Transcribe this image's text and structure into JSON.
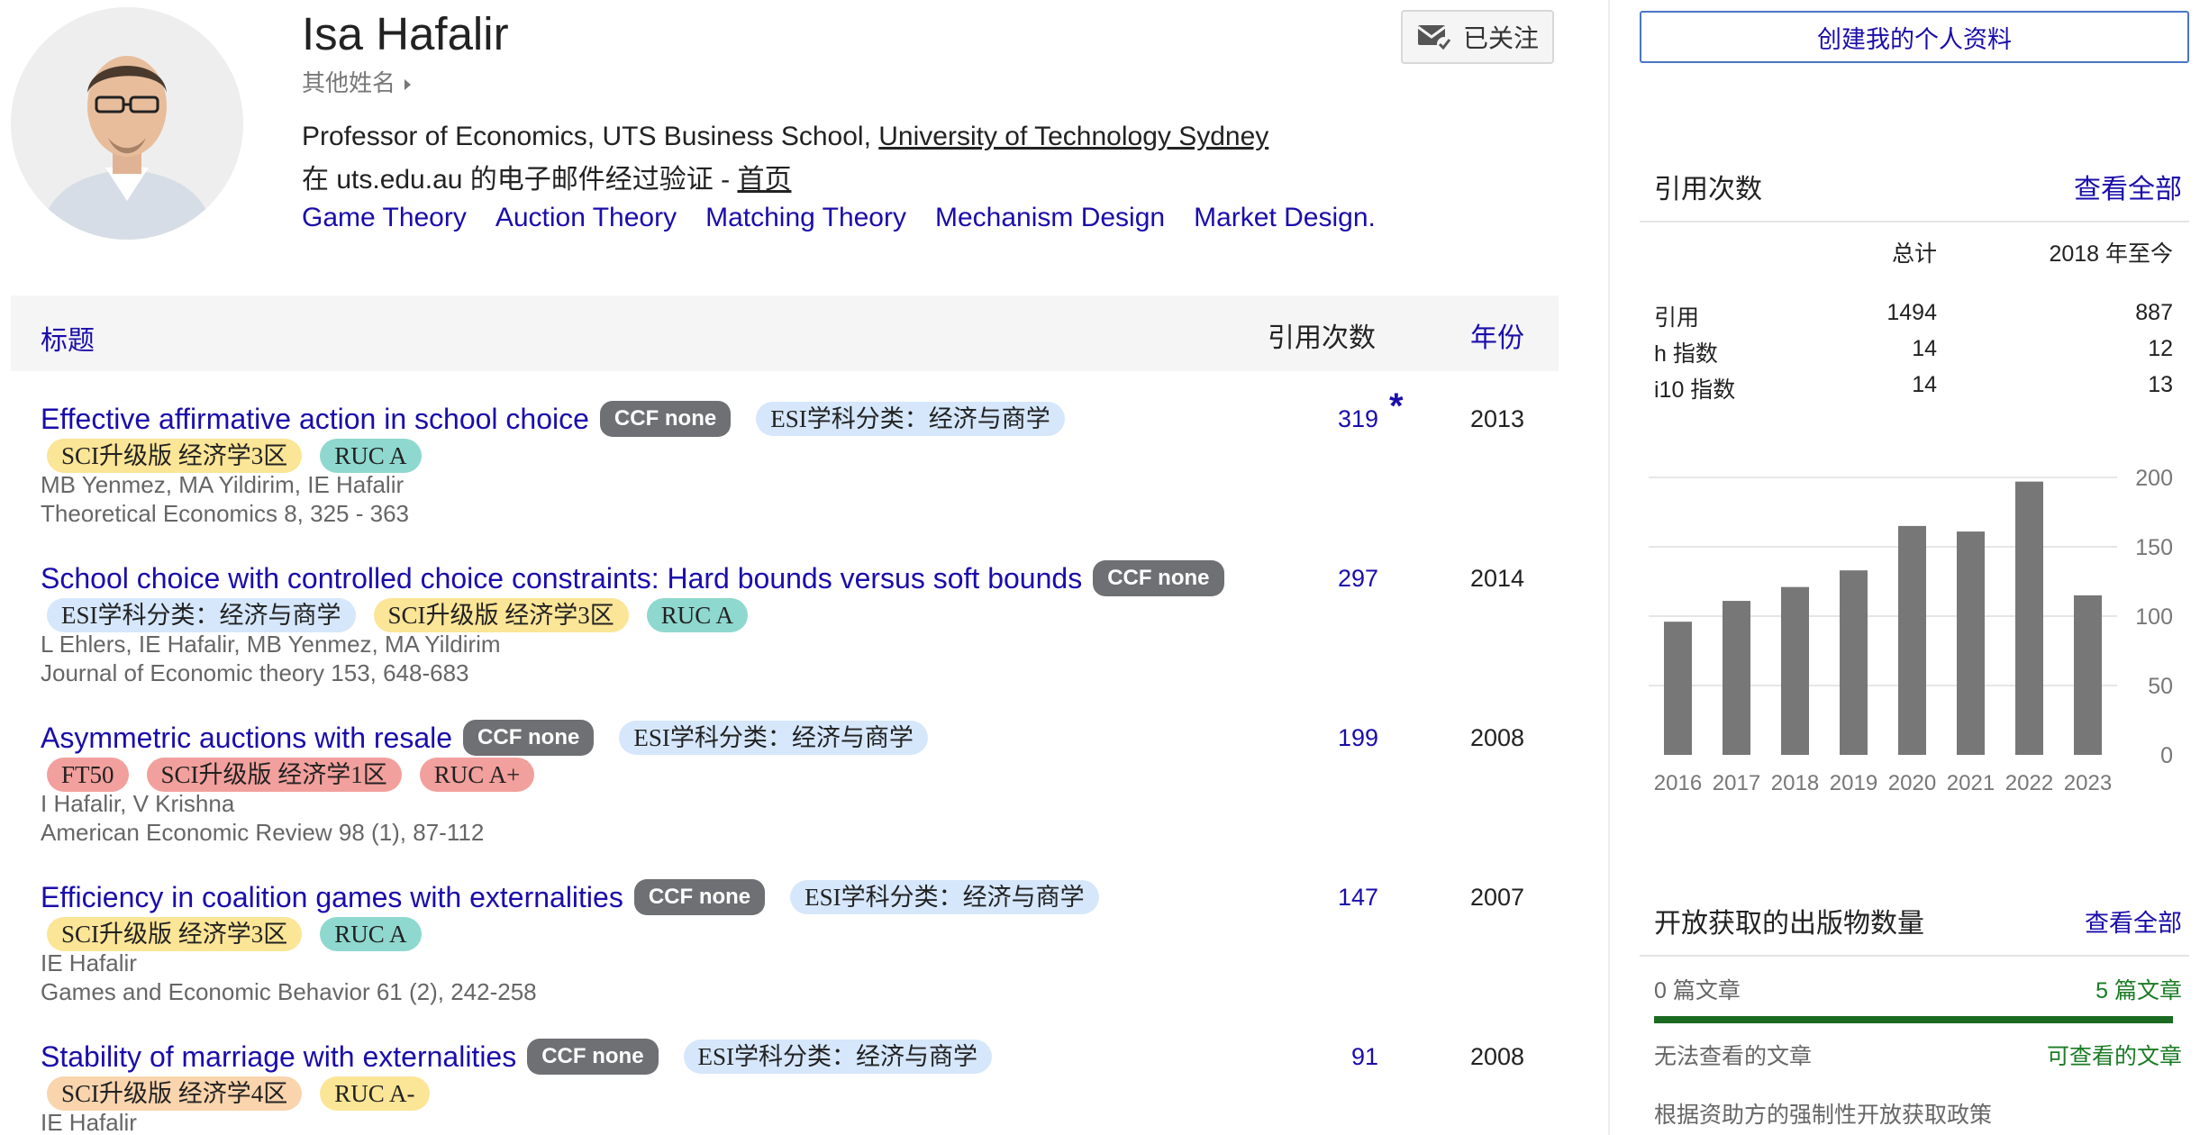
{
  "profile": {
    "name": "Isa Hafalir",
    "other_names": "其他姓名",
    "follow_label": "已关注",
    "affiliation_prefix": "Professor of Economics, UTS Business School, ",
    "affiliation_link": "University of Technology Sydney",
    "verified_prefix": "在 uts.edu.au 的电子邮件经过验证 - ",
    "homepage_label": "首页",
    "interests": [
      "Game Theory",
      "Auction Theory",
      "Matching Theory",
      "Mechanism Design",
      "Market Design."
    ]
  },
  "table": {
    "col_title": "标题",
    "col_cites": "引用次数",
    "col_year": "年份",
    "rows": [
      {
        "title": "Effective affirmative action in school choice",
        "tags1": [
          {
            "label": "CCF none",
            "kind": "ccf"
          },
          {
            "label": "ESI学科分类：经济与商学",
            "kind": "esi"
          }
        ],
        "tags2": [
          {
            "label": "SCI升级版 经济学3区",
            "kind": "sci3"
          },
          {
            "label": "RUC A",
            "kind": "ruca"
          }
        ],
        "authors": "MB Yenmez, MA Yildirim, IE Hafalir",
        "venue": "Theoretical Economics 8, 325 - 363",
        "cites": "319",
        "star": "*",
        "year": "2013"
      },
      {
        "title": "School choice with controlled choice constraints: Hard bounds versus soft bounds",
        "tags1": [
          {
            "label": "CCF none",
            "kind": "ccf"
          }
        ],
        "tags2": [
          {
            "label": "ESI学科分类：经济与商学",
            "kind": "esi"
          },
          {
            "label": "SCI升级版 经济学3区",
            "kind": "sci3"
          },
          {
            "label": "RUC A",
            "kind": "ruca"
          }
        ],
        "authors": "L Ehlers, IE Hafalir, MB Yenmez, MA Yildirim",
        "venue": "Journal of Economic theory 153, 648-683",
        "cites": "297",
        "year": "2014"
      },
      {
        "title": "Asymmetric auctions with resale",
        "tags1": [
          {
            "label": "CCF none",
            "kind": "ccf"
          },
          {
            "label": "ESI学科分类：经济与商学",
            "kind": "esi"
          }
        ],
        "tags2": [
          {
            "label": "FT50",
            "kind": "ft50"
          },
          {
            "label": "SCI升级版 经济学1区",
            "kind": "sci1"
          },
          {
            "label": "RUC A+",
            "kind": "rucap"
          }
        ],
        "authors": "I Hafalir, V Krishna",
        "venue": "American Economic Review 98 (1), 87-112",
        "cites": "199",
        "year": "2008"
      },
      {
        "title": "Efficiency in coalition games with externalities",
        "tags1": [
          {
            "label": "CCF none",
            "kind": "ccf"
          },
          {
            "label": "ESI学科分类：经济与商学",
            "kind": "esi"
          }
        ],
        "tags2": [
          {
            "label": "SCI升级版 经济学3区",
            "kind": "sci3"
          },
          {
            "label": "RUC A",
            "kind": "ruca"
          }
        ],
        "authors": "IE Hafalir",
        "venue": "Games and Economic Behavior 61 (2), 242-258",
        "cites": "147",
        "year": "2007"
      },
      {
        "title": "Stability of marriage with externalities",
        "tags1": [
          {
            "label": "CCF none",
            "kind": "ccf"
          },
          {
            "label": "ESI学科分类：经济与商学",
            "kind": "esi"
          }
        ],
        "tags2": [
          {
            "label": "SCI升级版 经济学4区",
            "kind": "sci4"
          },
          {
            "label": "RUC A-",
            "kind": "rucam"
          }
        ],
        "authors": "IE Hafalir",
        "venue": "",
        "cites": "91",
        "year": "2008"
      }
    ]
  },
  "sidebar": {
    "create_profile": "创建我的个人资料",
    "citations_title": "引用次数",
    "view_all": "查看全部",
    "col_total": "总计",
    "col_since": "2018 年至今",
    "stats": [
      {
        "label": "引用",
        "total": "1494",
        "since": "887"
      },
      {
        "label": "h 指数",
        "total": "14",
        "since": "12"
      },
      {
        "label": "i10 指数",
        "total": "14",
        "since": "13"
      }
    ],
    "oa_title": "开放获取的出版物数量",
    "oa_view_all": "查看全部",
    "oa_unavailable_count": "0 篇文章",
    "oa_available_count": "5 篇文章",
    "oa_available_fraction": 1.0,
    "oa_unavailable_label": "无法查看的文章",
    "oa_available_label": "可查看的文章",
    "oa_mandate": "根据资助方的强制性开放获取政策"
  },
  "chart_data": {
    "type": "bar",
    "categories": [
      "2016",
      "2017",
      "2018",
      "2019",
      "2020",
      "2021",
      "2022",
      "2023"
    ],
    "values": [
      96,
      111,
      121,
      133,
      165,
      161,
      197,
      115
    ],
    "ylim": [
      0,
      200
    ],
    "yticks": [
      0,
      50,
      100,
      150,
      200
    ],
    "bar_color": "#777777",
    "grid": true
  },
  "colors": {
    "link": "#1a0dab",
    "oa_green": "#1b6a22"
  }
}
